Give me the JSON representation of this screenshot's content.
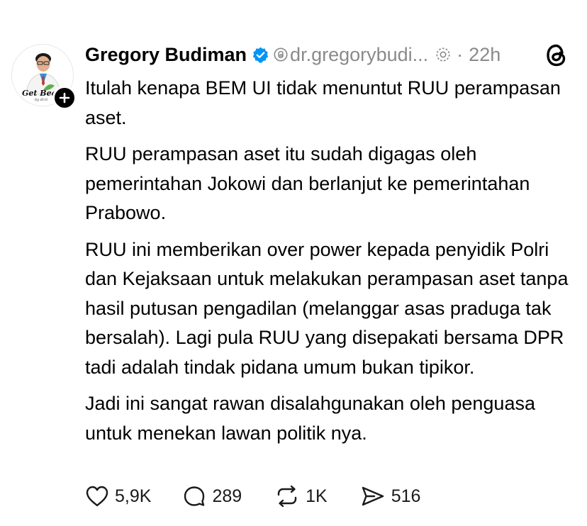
{
  "post": {
    "author": "Gregory Budiman",
    "handle": "dr.gregorybudi...",
    "time": "22h",
    "separator": "·",
    "avatar_text": "Get Bea",
    "avatar_subtext": "by dr.G",
    "paragraphs": [
      "Itulah kenapa BEM UI tidak menuntut RUU perampasan aset.",
      "RUU perampasan aset itu sudah digagas oleh pemerintahan Jokowi dan berlanjut ke pemerintahan Prabowo.",
      "RUU ini memberikan over power kepada penyidik Polri dan Kejaksaan untuk melakukan perampasan aset tanpa hasil putusan pengadilan (melanggar asas praduga tak bersalah). Lagi pula RUU yang disepakati bersama DPR tadi adalah tindak pidana umum bukan tipikor.",
      "Jadi ini sangat rawan disalahgunakan oleh penguasa untuk menekan lawan politik nya."
    ]
  },
  "actions": {
    "likes": "5,9K",
    "replies": "289",
    "reposts": "1K",
    "shares": "516"
  },
  "colors": {
    "verified": "#0095f6",
    "muted": "#8a8a8a",
    "text": "#000000"
  },
  "icons": {
    "verified": "verified-badge-icon",
    "threads": "threads-logo-icon",
    "like": "heart-icon",
    "reply": "comment-icon",
    "repost": "repost-icon",
    "share": "send-icon"
  }
}
